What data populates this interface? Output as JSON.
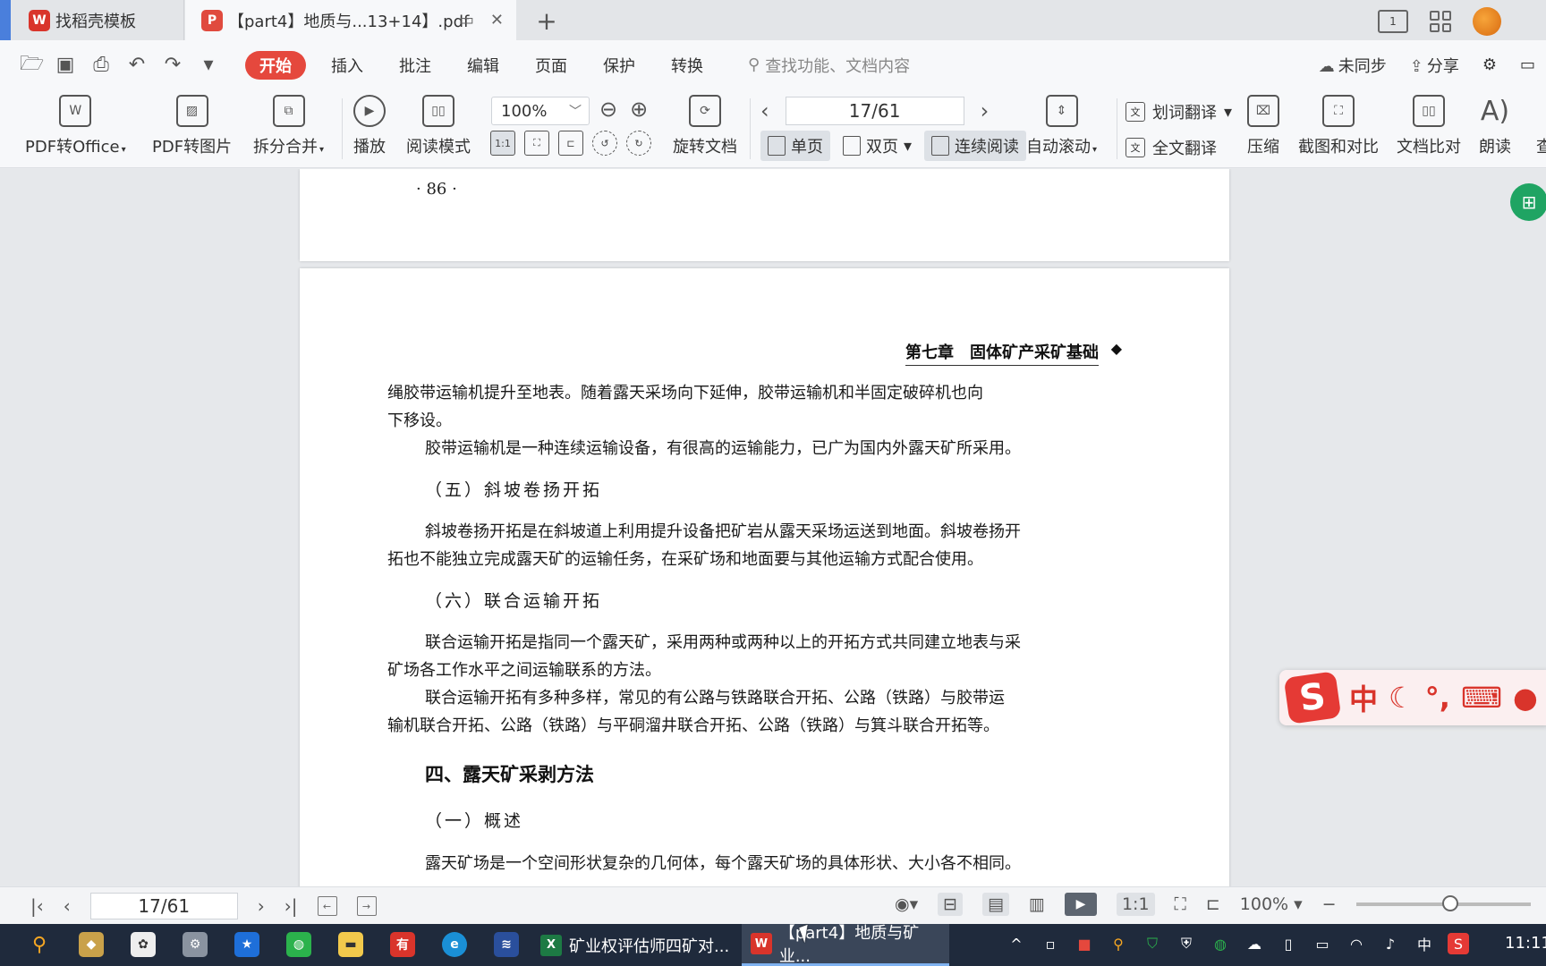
{
  "tabs": [
    {
      "label": "找稻壳模板",
      "icon": "wps-logo-icon"
    },
    {
      "label": "【part4】地质与...13+14】.pdf",
      "icon": "pdf-icon"
    }
  ],
  "menu": {
    "items": [
      "开始",
      "插入",
      "批注",
      "编辑",
      "页面",
      "保护",
      "转换"
    ],
    "search_placeholder": "查找功能、文档内容",
    "sync_label": "未同步",
    "share_label": "分享"
  },
  "ribbon": {
    "pdf_to_office": "PDF转Office",
    "pdf_to_image": "PDF转图片",
    "split_merge": "拆分合并",
    "play": "播放",
    "read_mode": "阅读模式",
    "zoom": "100%",
    "rotate_doc": "旋转文档",
    "page_indicator": "17/61",
    "single_page": "单页",
    "double_page": "双页",
    "continuous_read": "连续阅读",
    "auto_scroll": "自动滚动",
    "word_translate": "划词翻译",
    "full_translate": "全文翻译",
    "compress": "压缩",
    "screenshot_compare": "截图和对比",
    "doc_compare": "文档比对",
    "read_aloud": "朗读",
    "search_cut": "查"
  },
  "document": {
    "prev_page_number": "· 86 ·",
    "header": "第七章　固体矿产采矿基础",
    "paragraphs": [
      "绳胶带运输机提升至地表。随着露天采场向下延伸，胶带运输机和半固定破碎机也向",
      "下移设。",
      "胶带运输机是一种连续运输设备，有很高的运输能力，已广为国内外露天矿所采用。",
      "（五）斜坡卷扬开拓",
      "斜坡卷扬开拓是在斜坡道上利用提升设备把矿岩从露天采场运送到地面。斜坡卷扬开",
      "拓也不能独立完成露天矿的运输任务，在采矿场和地面要与其他运输方式配合使用。",
      "（六）联合运输开拓",
      "联合运输开拓是指同一个露天矿，采用两种或两种以上的开拓方式共同建立地表与采",
      "矿场各工作水平之间运输联系的方法。",
      "联合运输开拓有多种多样，常见的有公路与铁路联合开拓、公路（铁路）与胶带运",
      "输机联合开拓、公路（铁路）与平硐溜井联合开拓、公路（铁路）与箕斗联合开拓等。",
      "四、露天矿采剥方法",
      "（一）概述",
      "露天矿场是一个空间形状复杂的几何体，每个露天矿场的具体形状、大小各不相同。"
    ]
  },
  "ime": {
    "label": "中"
  },
  "statusbar": {
    "page_indicator": "17/61",
    "zoom": "100%"
  },
  "taskbar": {
    "apps": [
      {
        "label": "矿业权评估师四矿对...",
        "icon": "excel-icon"
      },
      {
        "label": "【part4】地质与矿业...",
        "icon": "wps-icon"
      }
    ],
    "tray_lang": "中",
    "clock": "11:11"
  },
  "colors": {
    "accent_red": "#e5483d",
    "taskbar_bg": "#1f2a3c",
    "doc_bg": "#e6e8eb",
    "green_float": "#1fa463"
  }
}
